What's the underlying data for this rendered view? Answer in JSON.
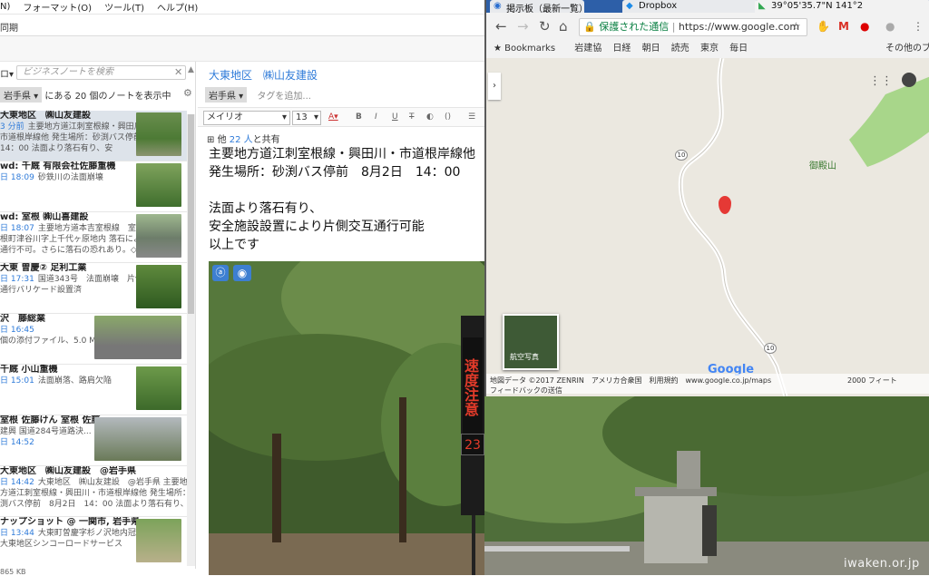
{
  "evernote": {
    "menu": [
      "N)",
      "フォーマット(O)",
      "ツール(T)",
      "ヘルプ(H)"
    ],
    "sync_label": "同期",
    "search": {
      "placeholder": "ビジネスノートを検索"
    },
    "filter": {
      "tag": "岩手県",
      "text": "にある 20 個のノートを表示中"
    },
    "notes": [
      {
        "title": "大東地区　㈱山友建設",
        "date": "3 分前",
        "snippet": "主要地方道江刺室根線・興田川",
        "snippet2": "市道根岸線他 発生場所：砂渕バス停前",
        "snippet3": "14：00 法面より落石有り、安"
      },
      {
        "title": "wd: 千厩 有限会社佐藤重機",
        "date": "日 18:09",
        "snippet": "砂鉄川の法面崩壊"
      },
      {
        "title": "wd: 室根 ㈱山喜建設",
        "date": "日 18:07",
        "snippet": "主要地方道本吉室根線　室",
        "snippet2": "根町津谷川字上千代ヶ原地内 落石により",
        "snippet3": "通行不可。さらに落石の恐れあり。◇"
      },
      {
        "title": "大東 曽慶② 足利工業",
        "date": "日 17:31",
        "snippet": "国道343号　法面崩壊　片側",
        "snippet2": "通行バリケード設置済"
      },
      {
        "title": "沢　藤総業",
        "date": "日 16:45",
        "snippet": "個の添付ファイル、5.0 MB"
      },
      {
        "title": "千厩 小山重機",
        "date": "日 15:01",
        "snippet": "法面崩落、路肩欠陥"
      },
      {
        "title": "室根 佐藤けん 室根 佐藤",
        "date": "日 14:52",
        "snippet": "建興 国道284号道路決..."
      },
      {
        "title": "大東地区　㈱山友建設　@岩手県",
        "date": "日 14:42",
        "snippet": "大東地区　㈱山友建設　@岩手県 主要地",
        "snippet2": "方道江刺室根線・興田川・市道根岸線他 発生場所：砂",
        "snippet3": "渕バス停前　8月2日　14：00 法面より落石有り、安全..."
      },
      {
        "title": "ナップショット @ 一関市, 岩手県",
        "date": "日 13:44",
        "snippet": "大東町曽慶字杉ノ沢地内冠水",
        "snippet2": "大東地区シンコーロードサービス"
      }
    ],
    "file_size": "865 KB",
    "editor": {
      "title": "大東地区　㈱山友建設",
      "tag": "岩手県",
      "tag_add": "タグを追加...",
      "font": "メイリオ",
      "size": "13",
      "shared_prefix": "他",
      "shared_count": "22 人",
      "shared_suffix": "と共有",
      "body": "主要地方道江刺室根線・興田川・市道根岸線他\n発生場所：砂渕バス停前　8月2日　14：00\n\n法面より落石有り、\n安全施設設置により片側交互通行可能\n以上です"
    },
    "sign_text": "速度注意",
    "sign_digits": "23"
  },
  "chrome": {
    "tabs": [
      "掲示板（最新一覧）",
      "Dropbox",
      "39°05'35.7\"N 141°2"
    ],
    "secure_label": "保護された通信",
    "url": "https://www.google.com",
    "bookmarks": [
      "Bookmarks",
      "岩建協",
      "日経",
      "朝日",
      "読売",
      "東京",
      "毎日",
      "その他のブ"
    ],
    "map": {
      "place": "御殿山",
      "route": "10",
      "aerial": "航空写真",
      "logo": "Google",
      "footer": "地図データ ©2017 ZENRIN　アメリカ合衆国　利用規約　www.google.co.jp/maps",
      "feedback": "フィードバックの送信",
      "scale": "2000 フィート"
    }
  },
  "watermark": "iwaken.or.jp"
}
